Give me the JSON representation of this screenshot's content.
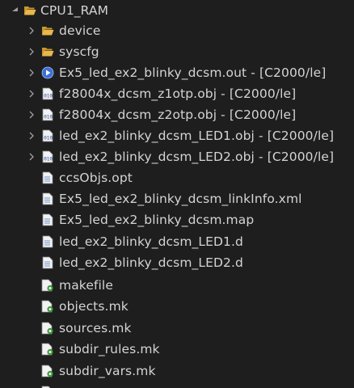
{
  "tree": {
    "root": {
      "label": "CPU1_RAM",
      "icon": "folder-open-icon",
      "expanded": true
    },
    "items": [
      {
        "label": "device",
        "icon": "folder-icon",
        "expandable": true
      },
      {
        "label": "syscfg",
        "icon": "folder-icon",
        "expandable": true
      },
      {
        "label": "Ex5_led_ex2_blinky_dcsm.out - [C2000/le]",
        "icon": "executable-icon",
        "expandable": true
      },
      {
        "label": "f28004x_dcsm_z1otp.obj - [C2000/le]",
        "icon": "object-file-icon",
        "expandable": true
      },
      {
        "label": "f28004x_dcsm_z2otp.obj - [C2000/le]",
        "icon": "object-file-icon",
        "expandable": true
      },
      {
        "label": "led_ex2_blinky_dcsm_LED1.obj - [C2000/le]",
        "icon": "object-file-icon",
        "expandable": true
      },
      {
        "label": "led_ex2_blinky_dcsm_LED2.obj - [C2000/le]",
        "icon": "object-file-icon",
        "expandable": true
      },
      {
        "label": "ccsObjs.opt",
        "icon": "text-file-icon",
        "expandable": false
      },
      {
        "label": "Ex5_led_ex2_blinky_dcsm_linkInfo.xml",
        "icon": "text-file-icon",
        "expandable": false
      },
      {
        "label": "Ex5_led_ex2_blinky_dcsm.map",
        "icon": "text-file-icon",
        "expandable": false
      },
      {
        "label": "led_ex2_blinky_dcsm_LED1.d",
        "icon": "text-file-icon",
        "expandable": false
      },
      {
        "label": "led_ex2_blinky_dcsm_LED2.d",
        "icon": "text-file-icon",
        "expandable": false
      },
      {
        "label": "makefile",
        "icon": "makefile-icon",
        "expandable": false
      },
      {
        "label": "objects.mk",
        "icon": "makefile-icon",
        "expandable": false
      },
      {
        "label": "sources.mk",
        "icon": "makefile-icon",
        "expandable": false
      },
      {
        "label": "subdir_rules.mk",
        "icon": "makefile-icon",
        "expandable": false
      },
      {
        "label": "subdir_vars.mk",
        "icon": "makefile-icon",
        "expandable": false
      }
    ]
  },
  "colors": {
    "background": "#1e1e1e",
    "text": "#d4d4d4",
    "folder": "#e8b84a",
    "chevron": "#a0a0a0"
  }
}
